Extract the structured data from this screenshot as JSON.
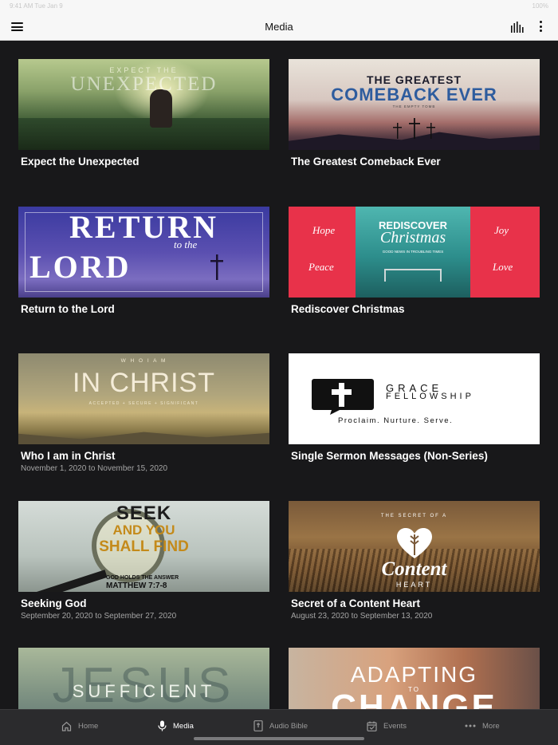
{
  "status_bar": {
    "left_text": "9:41 AM  Tue Jan 9",
    "right_text": "100%"
  },
  "nav": {
    "title": "Media"
  },
  "media": [
    {
      "title": "Expect the Unexpected",
      "subtitle": "",
      "thumb_line1": "EXPECT THE",
      "thumb_line2": "UNEXPECTED"
    },
    {
      "title": "The Greatest Comeback Ever",
      "subtitle": "",
      "thumb_line1": "THE GREATEST",
      "thumb_line2": "COMEBACK EVER",
      "thumb_line3": "THE EMPTY TOMB"
    },
    {
      "title": "Return to the Lord",
      "subtitle": "",
      "thumb_line1": "RETURN",
      "thumb_line2": "to the",
      "thumb_line3": "LORD"
    },
    {
      "title": "Rediscover Christmas",
      "subtitle": "",
      "thumb_line1": "REDISCOVER",
      "thumb_line2": "Christmas",
      "thumb_line3": "GOOD NEWS IN TROUBLING TIMES",
      "panels": [
        "Hope",
        "Joy",
        "Peace",
        "Love"
      ]
    },
    {
      "title": "Who I am in Christ",
      "subtitle": "November 1, 2020 to November 15, 2020",
      "thumb_line1": "W H O   I   A M",
      "thumb_line2": "IN CHRIST",
      "thumb_line3": "ACCEPTED + SECURE + SIGNIFICANT"
    },
    {
      "title": "Single Sermon Messages (Non-Series)",
      "subtitle": "",
      "thumb_line1": "GRACE",
      "thumb_line2": "FELLOWSHIP",
      "thumb_line3": "Proclaim. Nurture. Serve."
    },
    {
      "title": "Seeking God",
      "subtitle": "September 20, 2020 to September 27, 2020",
      "thumb_line1": "SEEK",
      "thumb_line2": "AND YOU",
      "thumb_line3": "SHALL FIND",
      "thumb_line4": "GOD HOLDS THE ANSWER",
      "thumb_line5": "MATTHEW 7:7-8"
    },
    {
      "title": "Secret of a Content Heart",
      "subtitle": "August 23, 2020 to September 13, 2020",
      "thumb_line1": "THE SECRET OF A",
      "thumb_line2": "Content",
      "thumb_line3": "HEART"
    },
    {
      "title": "",
      "subtitle": "",
      "thumb_line1": "JESUS",
      "thumb_line2": "SUFFICIENT"
    },
    {
      "title": "",
      "subtitle": "",
      "thumb_line1": "ADAPTING",
      "thumb_line2": "TO",
      "thumb_line3": "CHANGE"
    }
  ],
  "tabs": [
    {
      "label": "Home",
      "icon": "home-icon"
    },
    {
      "label": "Media",
      "icon": "microphone-icon"
    },
    {
      "label": "Audio Bible",
      "icon": "bible-icon"
    },
    {
      "label": "Events",
      "icon": "calendar-icon"
    },
    {
      "label": "More",
      "icon": "more-dots-icon"
    }
  ],
  "colors": {
    "background": "#18181a",
    "nav_bg": "#f7f7f7",
    "tab_bg": "#2b2b2d",
    "christmas_red": "#e8324a",
    "christmas_teal": "#2d8e8c"
  }
}
